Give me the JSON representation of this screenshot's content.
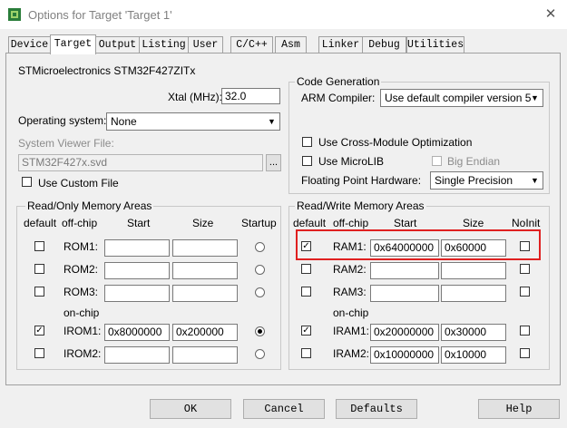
{
  "window": {
    "title": "Options for Target 'Target 1'",
    "close_glyph": "✕"
  },
  "tabs": [
    {
      "label": "Device"
    },
    {
      "label": "Target"
    },
    {
      "label": "Output"
    },
    {
      "label": "Listing"
    },
    {
      "label": "User"
    },
    {
      "label": "C/C++"
    },
    {
      "label": "Asm"
    },
    {
      "label": "Linker"
    },
    {
      "label": "Debug"
    },
    {
      "label": "Utilities"
    }
  ],
  "active_tab": "Target",
  "device": {
    "name": "STMicroelectronics STM32F427ZITx",
    "xtal_label": "Xtal (MHz):",
    "xtal_value": "32.0"
  },
  "os": {
    "label": "Operating system:",
    "value": "None"
  },
  "svd": {
    "label": "System Viewer File:",
    "value": "STM32F427x.svd",
    "browse_label": "...",
    "use_custom_label": "Use Custom File",
    "use_custom_checked": false
  },
  "codegen": {
    "title": "Code Generation",
    "compiler_label": "ARM Compiler:",
    "compiler_value": "Use default compiler version 5",
    "cross_module_label": "Use Cross-Module Optimization",
    "cross_module_checked": false,
    "microlib_label": "Use MicroLIB",
    "microlib_checked": false,
    "big_endian_label": "Big Endian",
    "big_endian_checked": false,
    "fph_label": "Floating Point Hardware:",
    "fph_value": "Single Precision"
  },
  "ro_memory": {
    "title": "Read/Only Memory Areas",
    "headers": {
      "default": "default",
      "offchip": "off-chip",
      "start": "Start",
      "size": "Size",
      "startup": "Startup"
    },
    "onchip_label": "on-chip",
    "rows": [
      {
        "name": "ROM1:",
        "default": false,
        "start": "",
        "size": "",
        "startup": false
      },
      {
        "name": "ROM2:",
        "default": false,
        "start": "",
        "size": "",
        "startup": false
      },
      {
        "name": "ROM3:",
        "default": false,
        "start": "",
        "size": "",
        "startup": false
      },
      {
        "name": "IROM1:",
        "default": true,
        "start": "0x8000000",
        "size": "0x200000",
        "startup": true
      },
      {
        "name": "IROM2:",
        "default": false,
        "start": "",
        "size": "",
        "startup": false
      }
    ]
  },
  "rw_memory": {
    "title": "Read/Write Memory Areas",
    "headers": {
      "default": "default",
      "offchip": "off-chip",
      "start": "Start",
      "size": "Size",
      "noinit": "NoInit"
    },
    "onchip_label": "on-chip",
    "rows": [
      {
        "name": "RAM1:",
        "default": true,
        "start": "0x64000000",
        "size": "0x60000",
        "noinit": false
      },
      {
        "name": "RAM2:",
        "default": false,
        "start": "",
        "size": "",
        "noinit": false
      },
      {
        "name": "RAM3:",
        "default": false,
        "start": "",
        "size": "",
        "noinit": false
      },
      {
        "name": "IRAM1:",
        "default": true,
        "start": "0x20000000",
        "size": "0x30000",
        "noinit": false
      },
      {
        "name": "IRAM2:",
        "default": false,
        "start": "0x10000000",
        "size": "0x10000",
        "noinit": false
      }
    ]
  },
  "buttons": {
    "ok": "OK",
    "cancel": "Cancel",
    "defaults": "Defaults",
    "help": "Help"
  },
  "glyphs": {
    "check": "✓",
    "combo_arrow": "▼"
  },
  "colors": {
    "highlight": "#e02020",
    "dialog_bg": "#f0f0f0"
  }
}
